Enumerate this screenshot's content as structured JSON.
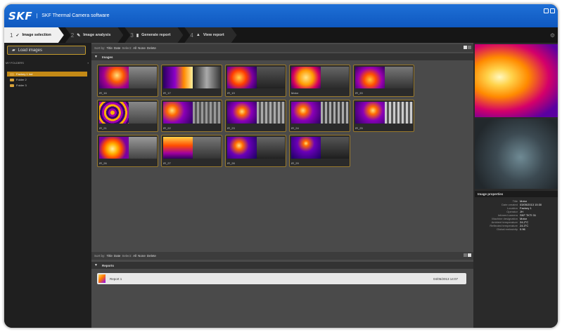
{
  "app": {
    "logo": "SKF",
    "title": "SKF Thermal Camera software"
  },
  "steps": [
    {
      "num": "1",
      "icon": "✓",
      "label": "Image selection"
    },
    {
      "num": "2",
      "icon": "✎",
      "label": "Image analysis"
    },
    {
      "num": "3",
      "icon": "▮",
      "label": "Generate report"
    },
    {
      "num": "4",
      "icon": "▲",
      "label": "View report"
    }
  ],
  "sidebar": {
    "load_label": "Load images",
    "folders_header": "MY FOLDERS",
    "folders": [
      "Factory 1 Ind",
      "Folder 2",
      "Folder 3"
    ]
  },
  "images_toolbar": {
    "sort_by": "Sort by:",
    "title": "Title",
    "date": "Date",
    "select": "Select:",
    "all": "All",
    "none": "None",
    "delete": "Delete"
  },
  "images_section": "Images",
  "thumbnails": [
    {
      "label": "IR_16"
    },
    {
      "label": "IR_17"
    },
    {
      "label": "IR_19"
    },
    {
      "label": "Motor"
    },
    {
      "label": "IR_20"
    },
    {
      "label": "IR_21"
    },
    {
      "label": "IR_22"
    },
    {
      "label": "IR_23"
    },
    {
      "label": "IR_24"
    },
    {
      "label": "IR_25"
    },
    {
      "label": "IR_26"
    },
    {
      "label": "IR_27"
    },
    {
      "label": "IR_28"
    },
    {
      "label": "IR_29"
    }
  ],
  "reports_toolbar": {
    "sort_by": "Sort by:",
    "title": "Title",
    "date": "Date",
    "select": "Select:",
    "all": "All",
    "none": "None",
    "delete": "Delete"
  },
  "reports_section": "Reports",
  "reports": [
    {
      "name": "Report 1",
      "date": "04/05/2013 14:07"
    }
  ],
  "properties": {
    "header": "Image properties",
    "rows": [
      {
        "k": "Title",
        "v": "Motor"
      },
      {
        "k": "Date created",
        "v": "03/05/2013 15:30"
      },
      {
        "k": "Location",
        "v": "Factory 1"
      },
      {
        "k": "Operator",
        "v": "JH"
      },
      {
        "k": "Infrared camera",
        "v": "SKF TKTI 31"
      },
      {
        "k": "Machine designation",
        "v": "Motor"
      },
      {
        "k": "Ambient temperature",
        "v": "24.2°C"
      },
      {
        "k": "Reflected temperature",
        "v": "24.3°C"
      },
      {
        "k": "Global emissivity",
        "v": "0.96"
      }
    ]
  }
}
